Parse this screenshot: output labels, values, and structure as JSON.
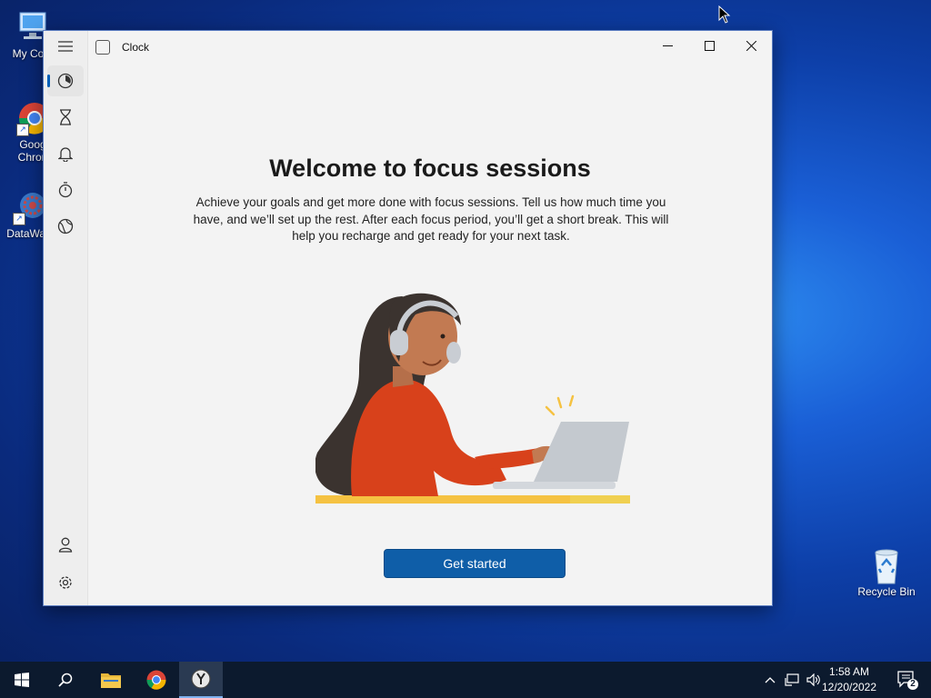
{
  "desktop": {
    "icons": [
      {
        "label": "My Com",
        "icon": "computer-icon"
      },
      {
        "label": "Goog Chron",
        "line1": "Goog",
        "line2": "Chron",
        "icon": "chrome-icon"
      },
      {
        "label": "DataWag",
        "icon": "datawag-icon"
      },
      {
        "label": "Recycle Bin",
        "icon": "recycle-bin-icon"
      }
    ]
  },
  "window": {
    "title": "Clock",
    "nav": [
      {
        "name": "focus-sessions",
        "icon": "focus-icon",
        "active": true
      },
      {
        "name": "timer",
        "icon": "hourglass-icon"
      },
      {
        "name": "alarm",
        "icon": "bell-icon"
      },
      {
        "name": "stopwatch",
        "icon": "stopwatch-icon"
      },
      {
        "name": "world-clock",
        "icon": "globe-icon"
      },
      {
        "name": "account",
        "icon": "person-icon"
      },
      {
        "name": "settings",
        "icon": "gear-icon"
      }
    ],
    "heading": "Welcome to focus sessions",
    "description": "Achieve your goals and get more done with focus sessions. Tell us how much time you have, and we’ll set up the rest. After each focus period, you’ll get a short break. This will help you recharge and get ready for your next task.",
    "primary_button": "Get started"
  },
  "taskbar": {
    "time": "1:58 AM",
    "date": "12/20/2022",
    "notification_count": "2",
    "colors": {
      "background": "#0c1a2e",
      "accent": "#0f5ea8"
    }
  }
}
